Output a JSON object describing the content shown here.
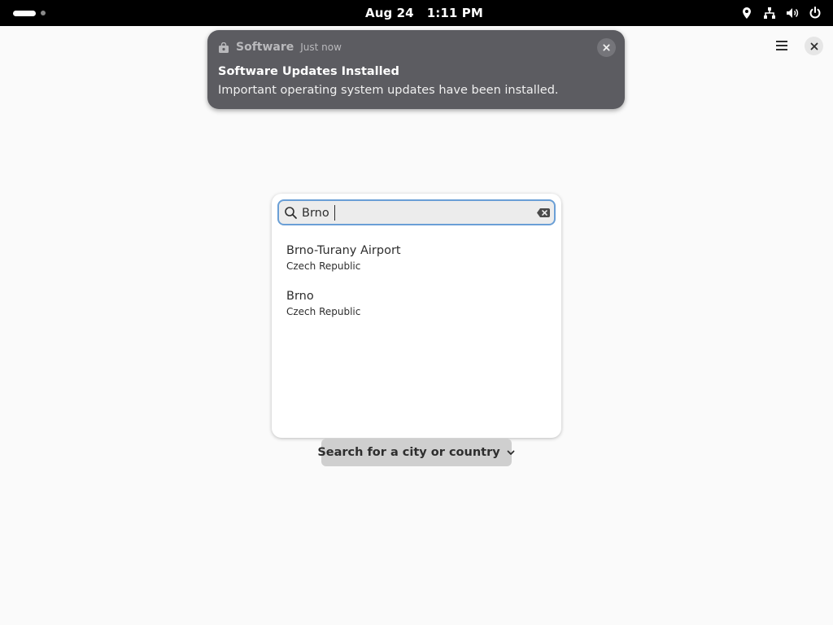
{
  "topbar": {
    "date": "Aug 24",
    "time": "1:11 PM",
    "icons": [
      "location-icon",
      "network-icon",
      "volume-icon",
      "power-icon"
    ]
  },
  "notification": {
    "app_name": "Software",
    "time": "Just now",
    "title": "Software Updates Installed",
    "body": "Important operating system updates have been installed."
  },
  "search": {
    "value": "Brno",
    "placeholder": ""
  },
  "results": [
    {
      "city": "Brno-Turany Airport",
      "country": "Czech Republic"
    },
    {
      "city": "Brno",
      "country": "Czech Republic"
    }
  ],
  "location_button": {
    "label": "Search for a city or country"
  },
  "colors": {
    "topbar": "#000000",
    "background": "#fafafa",
    "notification": "#5c5c61",
    "focus_ring": "#6a9fd6",
    "button": "#cfcfcf"
  }
}
